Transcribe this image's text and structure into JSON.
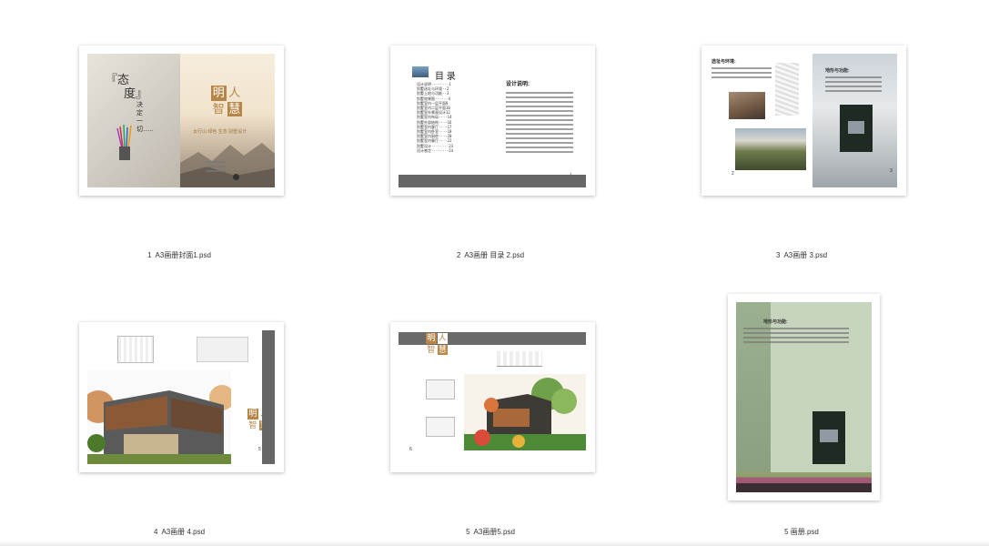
{
  "items": [
    {
      "index": "1",
      "name": "A3画册封面1.psd"
    },
    {
      "index": "2",
      "name": "A3画册 目录 2.psd"
    },
    {
      "index": "3",
      "name": "A3画册 3.psd"
    },
    {
      "index": "4",
      "name": "A3画册 4.psd"
    },
    {
      "index": "5",
      "name": "A3画册5.psd"
    },
    {
      "index": "",
      "name": "5 画册.psd"
    }
  ],
  "cover": {
    "quote_open": "『态",
    "quote_word": "度』",
    "vertical_text": "决定一切......",
    "logo_chars": [
      "明",
      "人",
      "智",
      "慧"
    ],
    "tagline": "太行山  绿色  生态  别墅设计"
  },
  "toc": {
    "title": "目  录",
    "desc_title": "设计说明:",
    "page_number": "1"
  },
  "page3": {
    "left_heading": "选址与环境:",
    "right_heading": "地形与功能:",
    "page_left": "2",
    "page_right": "3"
  },
  "page4": {
    "page_number": "5"
  },
  "page5": {
    "page_number": "6"
  },
  "page6": {
    "heading": "地形与功能:"
  }
}
